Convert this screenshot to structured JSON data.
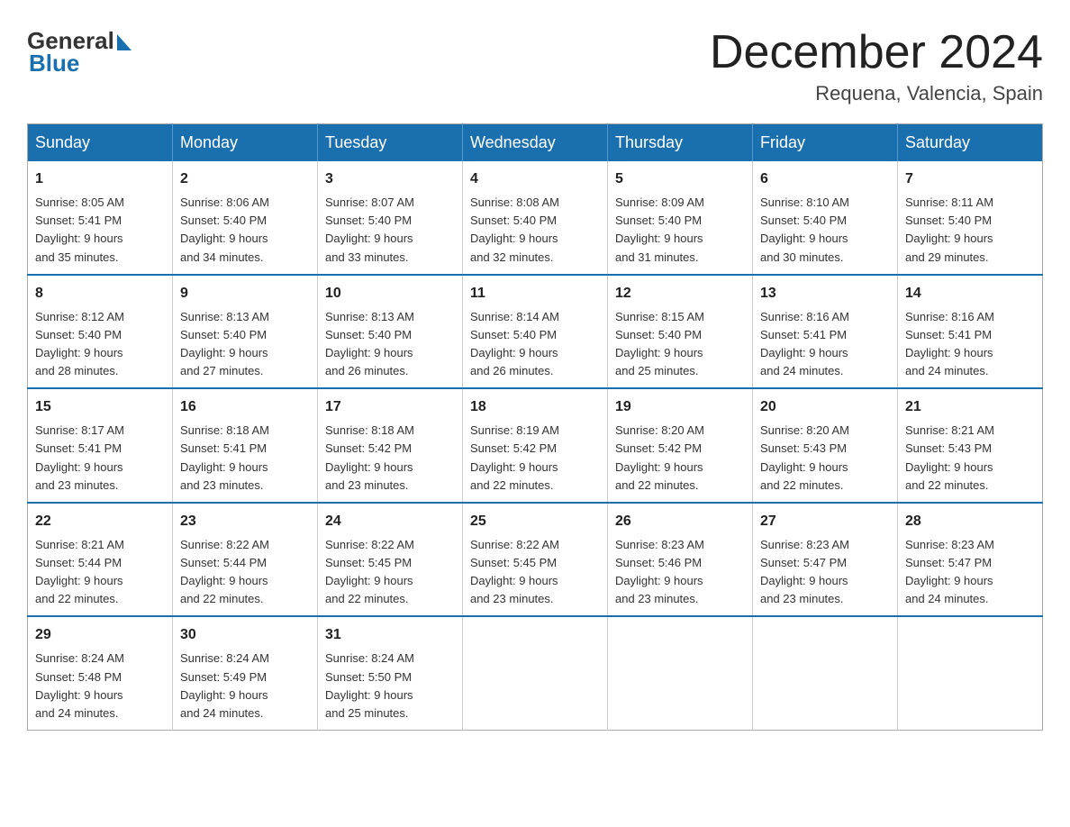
{
  "header": {
    "logo_general": "General",
    "logo_blue": "Blue",
    "month_title": "December 2024",
    "location": "Requena, Valencia, Spain"
  },
  "weekdays": [
    "Sunday",
    "Monday",
    "Tuesday",
    "Wednesday",
    "Thursday",
    "Friday",
    "Saturday"
  ],
  "weeks": [
    [
      {
        "day": "1",
        "sunrise": "8:05 AM",
        "sunset": "5:41 PM",
        "daylight": "9 hours and 35 minutes."
      },
      {
        "day": "2",
        "sunrise": "8:06 AM",
        "sunset": "5:40 PM",
        "daylight": "9 hours and 34 minutes."
      },
      {
        "day": "3",
        "sunrise": "8:07 AM",
        "sunset": "5:40 PM",
        "daylight": "9 hours and 33 minutes."
      },
      {
        "day": "4",
        "sunrise": "8:08 AM",
        "sunset": "5:40 PM",
        "daylight": "9 hours and 32 minutes."
      },
      {
        "day": "5",
        "sunrise": "8:09 AM",
        "sunset": "5:40 PM",
        "daylight": "9 hours and 31 minutes."
      },
      {
        "day": "6",
        "sunrise": "8:10 AM",
        "sunset": "5:40 PM",
        "daylight": "9 hours and 30 minutes."
      },
      {
        "day": "7",
        "sunrise": "8:11 AM",
        "sunset": "5:40 PM",
        "daylight": "9 hours and 29 minutes."
      }
    ],
    [
      {
        "day": "8",
        "sunrise": "8:12 AM",
        "sunset": "5:40 PM",
        "daylight": "9 hours and 28 minutes."
      },
      {
        "day": "9",
        "sunrise": "8:13 AM",
        "sunset": "5:40 PM",
        "daylight": "9 hours and 27 minutes."
      },
      {
        "day": "10",
        "sunrise": "8:13 AM",
        "sunset": "5:40 PM",
        "daylight": "9 hours and 26 minutes."
      },
      {
        "day": "11",
        "sunrise": "8:14 AM",
        "sunset": "5:40 PM",
        "daylight": "9 hours and 26 minutes."
      },
      {
        "day": "12",
        "sunrise": "8:15 AM",
        "sunset": "5:40 PM",
        "daylight": "9 hours and 25 minutes."
      },
      {
        "day": "13",
        "sunrise": "8:16 AM",
        "sunset": "5:41 PM",
        "daylight": "9 hours and 24 minutes."
      },
      {
        "day": "14",
        "sunrise": "8:16 AM",
        "sunset": "5:41 PM",
        "daylight": "9 hours and 24 minutes."
      }
    ],
    [
      {
        "day": "15",
        "sunrise": "8:17 AM",
        "sunset": "5:41 PM",
        "daylight": "9 hours and 23 minutes."
      },
      {
        "day": "16",
        "sunrise": "8:18 AM",
        "sunset": "5:41 PM",
        "daylight": "9 hours and 23 minutes."
      },
      {
        "day": "17",
        "sunrise": "8:18 AM",
        "sunset": "5:42 PM",
        "daylight": "9 hours and 23 minutes."
      },
      {
        "day": "18",
        "sunrise": "8:19 AM",
        "sunset": "5:42 PM",
        "daylight": "9 hours and 22 minutes."
      },
      {
        "day": "19",
        "sunrise": "8:20 AM",
        "sunset": "5:42 PM",
        "daylight": "9 hours and 22 minutes."
      },
      {
        "day": "20",
        "sunrise": "8:20 AM",
        "sunset": "5:43 PM",
        "daylight": "9 hours and 22 minutes."
      },
      {
        "day": "21",
        "sunrise": "8:21 AM",
        "sunset": "5:43 PM",
        "daylight": "9 hours and 22 minutes."
      }
    ],
    [
      {
        "day": "22",
        "sunrise": "8:21 AM",
        "sunset": "5:44 PM",
        "daylight": "9 hours and 22 minutes."
      },
      {
        "day": "23",
        "sunrise": "8:22 AM",
        "sunset": "5:44 PM",
        "daylight": "9 hours and 22 minutes."
      },
      {
        "day": "24",
        "sunrise": "8:22 AM",
        "sunset": "5:45 PM",
        "daylight": "9 hours and 22 minutes."
      },
      {
        "day": "25",
        "sunrise": "8:22 AM",
        "sunset": "5:45 PM",
        "daylight": "9 hours and 23 minutes."
      },
      {
        "day": "26",
        "sunrise": "8:23 AM",
        "sunset": "5:46 PM",
        "daylight": "9 hours and 23 minutes."
      },
      {
        "day": "27",
        "sunrise": "8:23 AM",
        "sunset": "5:47 PM",
        "daylight": "9 hours and 23 minutes."
      },
      {
        "day": "28",
        "sunrise": "8:23 AM",
        "sunset": "5:47 PM",
        "daylight": "9 hours and 24 minutes."
      }
    ],
    [
      {
        "day": "29",
        "sunrise": "8:24 AM",
        "sunset": "5:48 PM",
        "daylight": "9 hours and 24 minutes."
      },
      {
        "day": "30",
        "sunrise": "8:24 AM",
        "sunset": "5:49 PM",
        "daylight": "9 hours and 24 minutes."
      },
      {
        "day": "31",
        "sunrise": "8:24 AM",
        "sunset": "5:50 PM",
        "daylight": "9 hours and 25 minutes."
      },
      null,
      null,
      null,
      null
    ]
  ],
  "labels": {
    "sunrise": "Sunrise:",
    "sunset": "Sunset:",
    "daylight": "Daylight:"
  }
}
